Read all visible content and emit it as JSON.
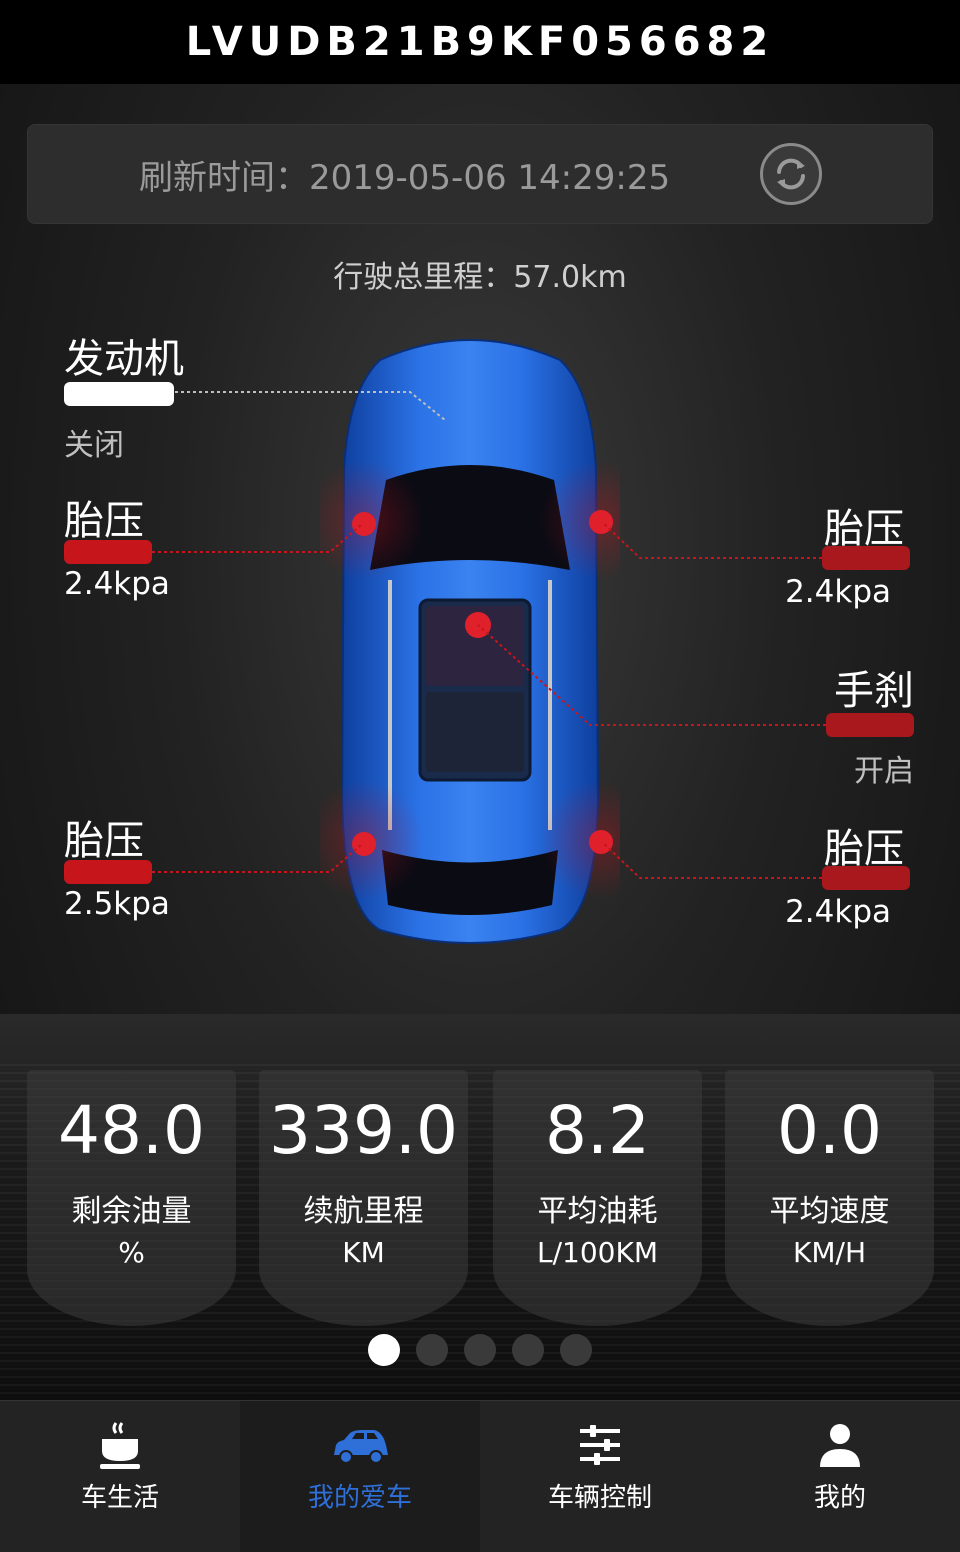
{
  "header": {
    "title": "LVUDB21B9KF056682"
  },
  "refresh": {
    "label": "刷新时间：2019-05-06 14:29:25"
  },
  "mileage": {
    "label": "行驶总里程：57.0km"
  },
  "car_status": {
    "engine": {
      "title": "发动机",
      "state": "关闭"
    },
    "tire_front_left": {
      "title": "胎压",
      "value": "2.4kpa"
    },
    "tire_front_right": {
      "title": "胎压",
      "value": "2.4kpa"
    },
    "handbrake": {
      "title": "手刹",
      "state": "开启"
    },
    "tire_rear_left": {
      "title": "胎压",
      "value": "2.5kpa"
    },
    "tire_rear_right": {
      "title": "胎压",
      "value": "2.4kpa"
    }
  },
  "stats": [
    {
      "value": "48.0",
      "label": "剩余油量",
      "unit": "%"
    },
    {
      "value": "339.0",
      "label": "续航里程",
      "unit": "KM"
    },
    {
      "value": "8.2",
      "label": "平均油耗",
      "unit": "L/100KM"
    },
    {
      "value": "0.0",
      "label": "平均速度",
      "unit": "KM/H"
    }
  ],
  "pager": {
    "total": 5,
    "active": 1
  },
  "nav": [
    {
      "label": "车生活",
      "icon": "coffee-cup-icon"
    },
    {
      "label": "我的爱车",
      "icon": "car-icon",
      "active": true
    },
    {
      "label": "车辆控制",
      "icon": "sliders-icon"
    },
    {
      "label": "我的",
      "icon": "person-icon"
    }
  ],
  "colors": {
    "accent_blue": "#2e6fd8",
    "alert_red": "#c7161b",
    "car_blue": "#1d5fd6"
  }
}
